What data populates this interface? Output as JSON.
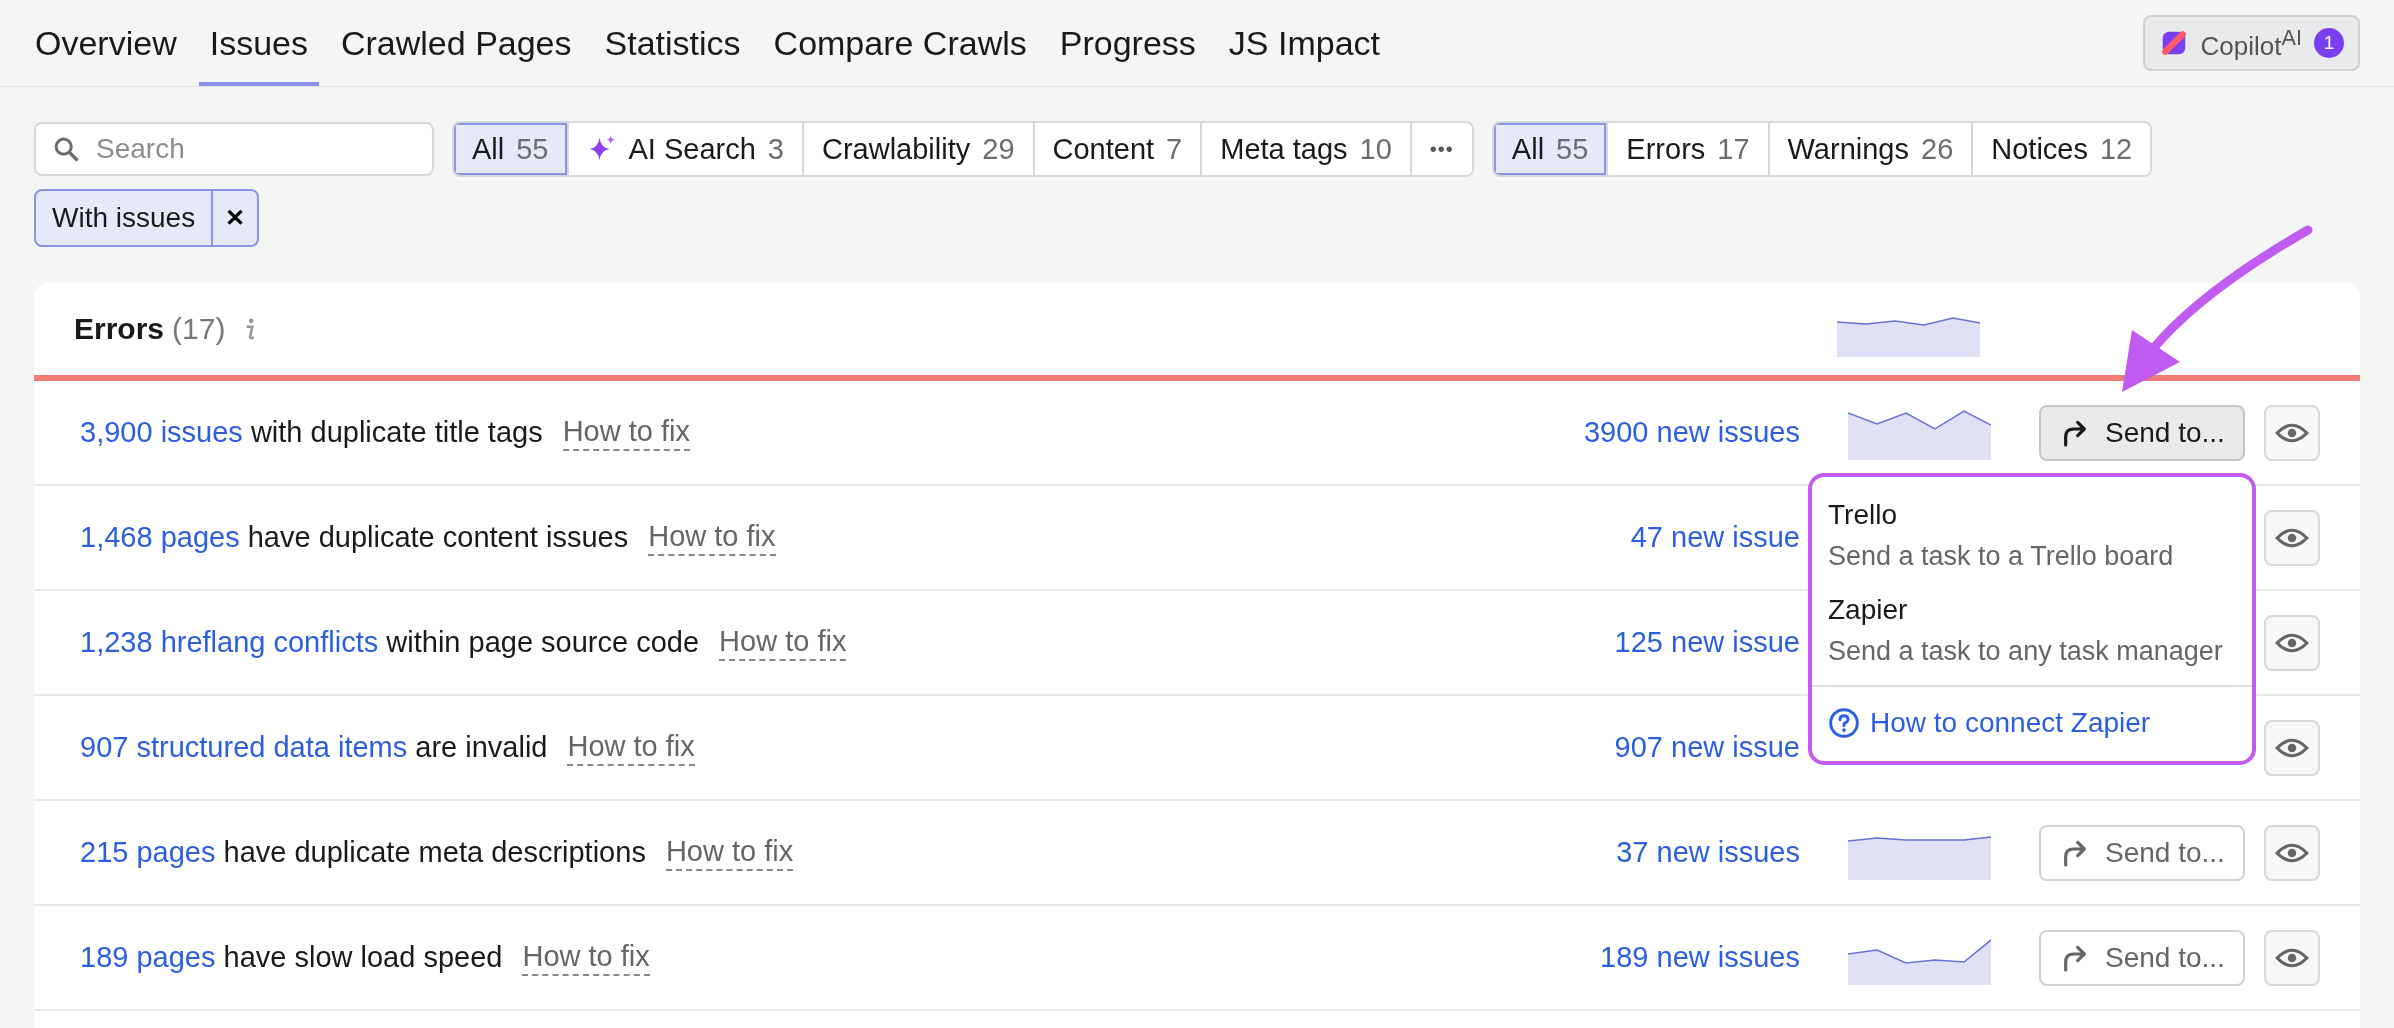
{
  "tabs": [
    {
      "label": "Overview",
      "selected": false
    },
    {
      "label": "Issues",
      "selected": true
    },
    {
      "label": "Crawled Pages",
      "selected": false
    },
    {
      "label": "Statistics",
      "selected": false
    },
    {
      "label": "Compare Crawls",
      "selected": false
    },
    {
      "label": "Progress",
      "selected": false
    },
    {
      "label": "JS Impact",
      "selected": false
    }
  ],
  "copilot": {
    "label": "Copilot$^{AI}$",
    "badge": "1"
  },
  "search": {
    "placeholder": "Search"
  },
  "category_filters": [
    {
      "kind": "plain",
      "label": "All",
      "count": "55",
      "selected": true
    },
    {
      "kind": "ai",
      "label": "AI Search",
      "count": "3",
      "selected": false
    },
    {
      "kind": "plain",
      "label": "Crawlability",
      "count": "29",
      "selected": false
    },
    {
      "kind": "plain",
      "label": "Content",
      "count": "7",
      "selected": false
    },
    {
      "kind": "plain",
      "label": "Meta tags",
      "count": "10",
      "selected": false
    },
    {
      "kind": "more",
      "label": "•••",
      "selected": false
    }
  ],
  "severity_filters": [
    {
      "label": "All",
      "count": "55",
      "selected": true
    },
    {
      "label": "Errors",
      "count": "17",
      "selected": false
    },
    {
      "label": "Warnings",
      "count": "26",
      "selected": false
    },
    {
      "label": "Notices",
      "count": "12",
      "selected": false
    }
  ],
  "active_filter": {
    "label": "With issues",
    "remove": "✕"
  },
  "errors_panel": {
    "title": "Errors",
    "count": "(17)",
    "rows": [
      {
        "link": "3,900 issues",
        "text": " with duplicate title tags",
        "fix": "How to fix",
        "new_issues": "3900 new issues",
        "send_button": "Send to..."
      },
      {
        "link": "1,468 pages",
        "text": " have duplicate content issues",
        "fix": "How to fix",
        "new_issues": "47 new issue"
      },
      {
        "link": "1,238 hreflang conflicts",
        "text": " within page source code",
        "fix": "How to fix",
        "new_issues": "125 new issue"
      },
      {
        "link": "907 structured data items",
        "text": " are invalid",
        "fix": "How to fix",
        "new_issues": "907 new issue"
      },
      {
        "link": "215 pages",
        "text": " have duplicate meta descriptions",
        "fix": "How to fix",
        "new_issues": "37 new issues",
        "send_button": "Send to..."
      },
      {
        "link": "189 pages",
        "text": " have slow load speed",
        "fix": "How to fix",
        "new_issues": "189 new issues",
        "send_button": "Send to..."
      }
    ]
  },
  "send_menu": {
    "items": [
      {
        "title": "Trello",
        "description": "Send a task to a Trello board"
      },
      {
        "title": "Zapier",
        "description": "Send a task to any task manager"
      }
    ],
    "help_link": "How to connect Zapier"
  }
}
